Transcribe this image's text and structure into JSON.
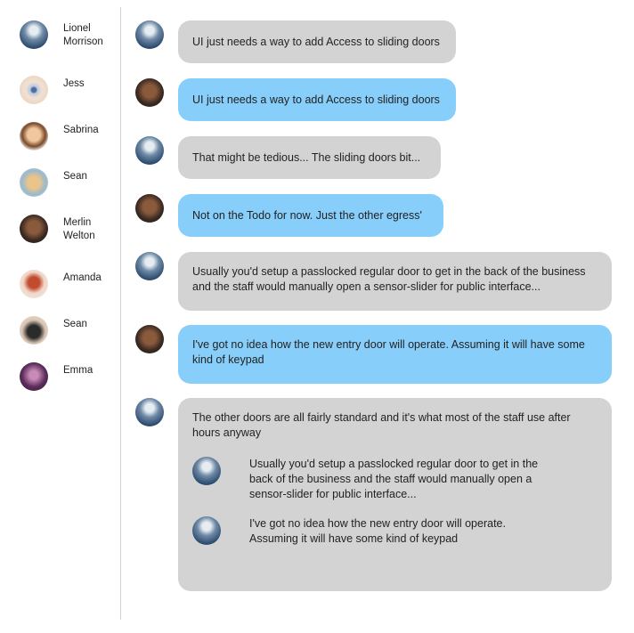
{
  "sidebar": {
    "contacts": [
      {
        "name": "Lionel Morrison"
      },
      {
        "name": "Jess"
      },
      {
        "name": "Sabrina"
      },
      {
        "name": "Sean"
      },
      {
        "name": "Merlin Welton"
      },
      {
        "name": "Amanda"
      },
      {
        "name": "Sean"
      },
      {
        "name": "Emma"
      }
    ]
  },
  "messages": [
    {
      "sender": "Lionel Morrison",
      "text": "UI just needs a way to add Access to sliding doors"
    },
    {
      "sender": "Merlin Welton",
      "text": "UI just needs a way to add Access to sliding doors"
    },
    {
      "sender": "Lionel Morrison",
      "text": "That might be tedious... The sliding doors bit..."
    },
    {
      "sender": "Merlin Welton",
      "text": "Not on the Todo for now. Just the other egress'"
    },
    {
      "sender": "Lionel Morrison",
      "text": "Usually you'd setup a passlocked regular door to get in the back of the business and the staff would manually open a sensor-slider for public interface..."
    },
    {
      "sender": "Merlin Welton",
      "text": "I've got no idea how the new entry door will operate. Assuming it will have some kind of keypad"
    },
    {
      "sender": "Lionel Morrison",
      "text": "The other doors are all fairly standard and it's what most of the staff use after hours anyway",
      "quotes": [
        {
          "text": "Usually you'd setup a passlocked regular door to get in the back of the business and the staff would manually open a sensor-slider for public interface..."
        },
        {
          "text": "I've got no idea how the new entry door will operate. Assuming it will have some kind of keypad"
        }
      ]
    }
  ],
  "colors": {
    "incoming_bubble": "#d3d3d3",
    "outgoing_bubble": "#87cefa",
    "divider": "#d2d2d2"
  }
}
